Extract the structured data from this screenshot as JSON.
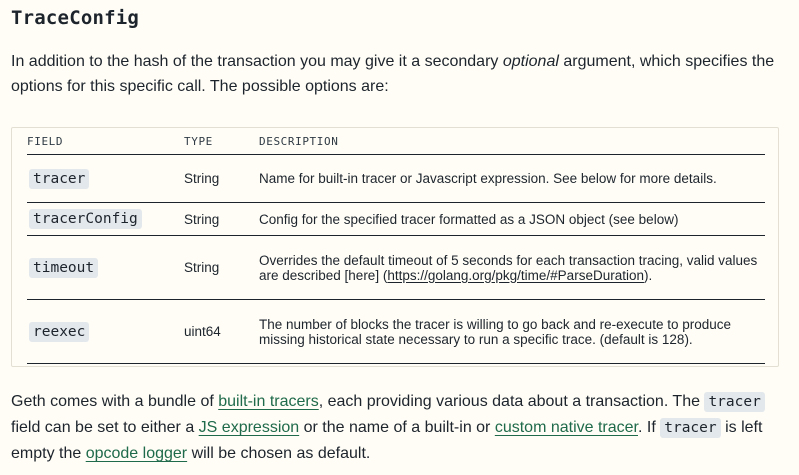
{
  "heading": "TraceConfig",
  "intro": {
    "before": "In addition to the hash of the transaction you may give it a secondary ",
    "emph": "optional",
    "after": " argument, which specifies the options for this specific call. The possible options are:"
  },
  "table": {
    "headers": [
      "FIELD",
      "TYPE",
      "DESCRIPTION"
    ],
    "rows": [
      {
        "field": "tracer",
        "type": "String",
        "desc": "Name for built-in tracer or Javascript expression. See below for more details."
      },
      {
        "field": "tracerConfig",
        "type": "String",
        "desc": "Config for the specified tracer formatted as a JSON object (see below)"
      },
      {
        "field": "timeout",
        "type": "String",
        "desc": "Overrides the default timeout of 5 seconds for each transaction tracing, valid values are described [here] (",
        "link": "https://golang.org/pkg/time/#ParseDuration",
        "desc_after": ")."
      },
      {
        "field": "reexec",
        "type": "uint64",
        "desc": "The number of blocks the tracer is willing to go back and re-execute to produce missing historical state necessary to run a specific trace. (default is 128)."
      }
    ]
  },
  "outro": {
    "t1": "Geth comes with a bundle of ",
    "link1": "built-in tracers",
    "t2": ", each providing various data about a transaction. The ",
    "code1": "tracer",
    "t3": " field can be set to either a ",
    "link2": "JS expression",
    "t4": " or the name of a built-in or ",
    "link3": "custom native tracer",
    "t5": ". If ",
    "code2": "tracer",
    "t6": " is left empty the ",
    "link4": "opcode logger",
    "t7": " will be chosen as default."
  }
}
